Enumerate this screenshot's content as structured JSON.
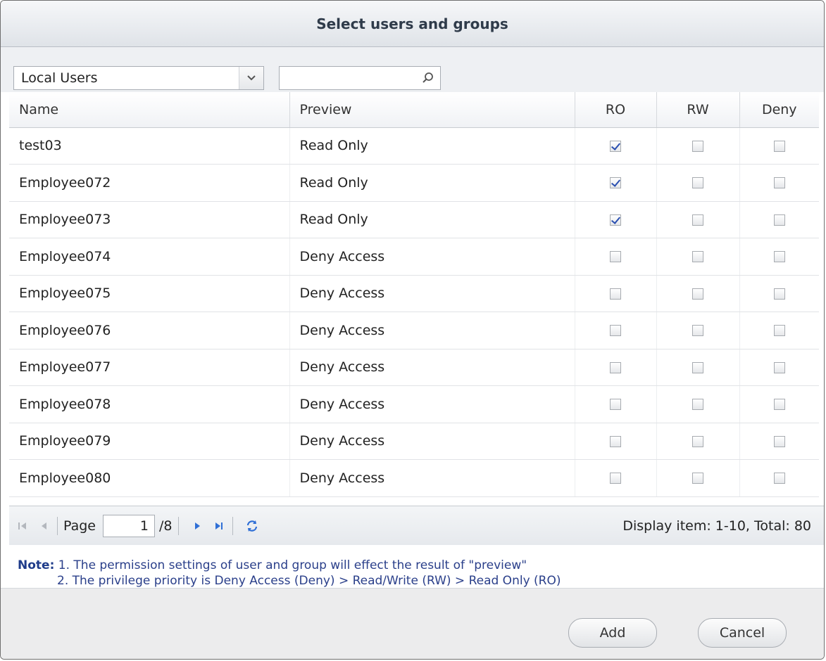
{
  "dialog": {
    "title": "Select users and groups"
  },
  "toolbar": {
    "selected_scope": "Local Users",
    "search_value": "",
    "search_placeholder": ""
  },
  "table": {
    "headers": {
      "name": "Name",
      "preview": "Preview",
      "ro": "RO",
      "rw": "RW",
      "deny": "Deny"
    },
    "rows": [
      {
        "name": "test03",
        "preview": "Read Only",
        "ro": true,
        "rw": false,
        "deny": false
      },
      {
        "name": "Employee072",
        "preview": "Read Only",
        "ro": true,
        "rw": false,
        "deny": false
      },
      {
        "name": "Employee073",
        "preview": "Read Only",
        "ro": true,
        "rw": false,
        "deny": false
      },
      {
        "name": "Employee074",
        "preview": "Deny Access",
        "ro": false,
        "rw": false,
        "deny": false
      },
      {
        "name": "Employee075",
        "preview": "Deny Access",
        "ro": false,
        "rw": false,
        "deny": false
      },
      {
        "name": "Employee076",
        "preview": "Deny Access",
        "ro": false,
        "rw": false,
        "deny": false
      },
      {
        "name": "Employee077",
        "preview": "Deny Access",
        "ro": false,
        "rw": false,
        "deny": false
      },
      {
        "name": "Employee078",
        "preview": "Deny Access",
        "ro": false,
        "rw": false,
        "deny": false
      },
      {
        "name": "Employee079",
        "preview": "Deny Access",
        "ro": false,
        "rw": false,
        "deny": false
      },
      {
        "name": "Employee080",
        "preview": "Deny Access",
        "ro": false,
        "rw": false,
        "deny": false
      }
    ]
  },
  "pager": {
    "page_label": "Page",
    "page_value": "1",
    "page_total": "/8",
    "display_text": "Display item: 1-10, Total: 80"
  },
  "note": {
    "label": "Note:",
    "line1": "1. The permission settings of user and group will effect the result of \"preview\"",
    "line2": "2. The privilege priority is Deny Access (Deny) > Read/Write (RW) > Read Only (RO)"
  },
  "buttons": {
    "add": "Add",
    "cancel": "Cancel"
  },
  "colors": {
    "read_only": "#e2a400",
    "deny_access": "#cc2020",
    "note_text": "#2a3f8a"
  }
}
